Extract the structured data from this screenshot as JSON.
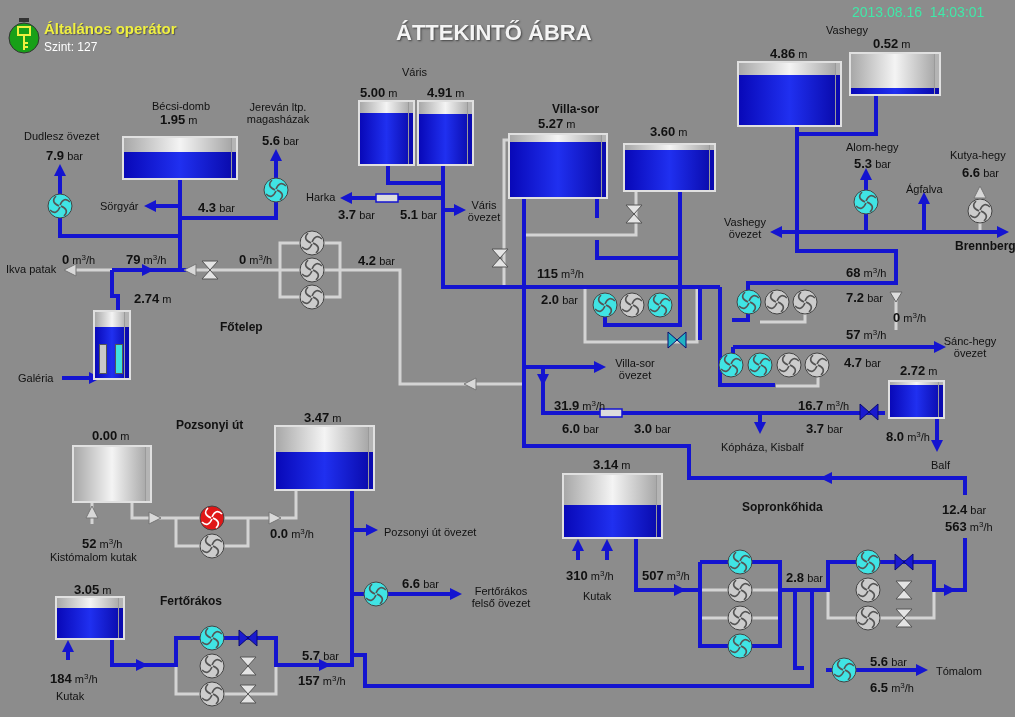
{
  "header": {
    "operator": "Általános operátor",
    "level_label": "Szint: 127",
    "title": "ÁTTEKINTŐ ÁBRA",
    "datetime": "2013.08.16  14:03:01"
  },
  "tanks": [
    {
      "kind": "tank",
      "reading": "1.95",
      "unit": "m",
      "level": 0.66
    },
    {
      "kind": "tank",
      "reading": "5.00",
      "unit": "m",
      "level": 0.82
    },
    {
      "kind": "tank",
      "reading": "4.91",
      "unit": "m",
      "level": 0.8
    },
    {
      "kind": "tank",
      "reading": "5.27",
      "unit": "m",
      "level": 0.88
    },
    {
      "kind": "tank",
      "reading": "3.60",
      "unit": "m",
      "level": 0.9
    },
    {
      "kind": "tank",
      "reading": "4.86",
      "unit": "m",
      "level": 0.8
    },
    {
      "kind": "tank",
      "reading": "0.52",
      "unit": "m",
      "level": 0.16
    },
    {
      "kind": "tank",
      "reading": "2.72",
      "unit": "m",
      "level": 0.92
    },
    {
      "kind": "tank",
      "reading": "0.00",
      "unit": "m",
      "level": 0
    },
    {
      "kind": "tank",
      "reading": "3.47",
      "unit": "m",
      "level": 0.59
    },
    {
      "kind": "tank",
      "reading": "3.05",
      "unit": "m",
      "level": 0.75
    },
    {
      "kind": "tank",
      "reading": "3.14",
      "unit": "m",
      "level": 0.52
    },
    {
      "kind": "well",
      "reading": "2.74",
      "unit": "m",
      "level": 0.78
    }
  ],
  "pumps": [
    {
      "on": true,
      "alarm": false
    },
    {
      "on": true,
      "alarm": false
    },
    {
      "on": false,
      "alarm": false
    },
    {
      "on": false,
      "alarm": false
    },
    {
      "on": false,
      "alarm": false
    },
    {
      "on": true,
      "alarm": false
    },
    {
      "on": false,
      "alarm": false
    },
    {
      "on": true,
      "alarm": false
    },
    {
      "on": true,
      "alarm": false
    },
    {
      "on": false,
      "alarm": false
    },
    {
      "on": false,
      "alarm": false
    },
    {
      "on": true,
      "alarm": false
    },
    {
      "on": true,
      "alarm": false
    },
    {
      "on": false,
      "alarm": false
    },
    {
      "on": false,
      "alarm": false
    },
    {
      "on": true,
      "alarm": false
    },
    {
      "on": false,
      "alarm": false
    },
    {
      "on": false,
      "alarm": true
    },
    {
      "on": false,
      "alarm": false
    },
    {
      "on": true,
      "alarm": false
    },
    {
      "on": true,
      "alarm": false
    },
    {
      "on": false,
      "alarm": false
    },
    {
      "on": false,
      "alarm": false
    },
    {
      "on": true,
      "alarm": false
    },
    {
      "on": false,
      "alarm": false
    },
    {
      "on": false,
      "alarm": false
    },
    {
      "on": true,
      "alarm": false
    },
    {
      "on": true,
      "alarm": false
    },
    {
      "on": false,
      "alarm": false
    },
    {
      "on": false,
      "alarm": false
    },
    {
      "on": true,
      "alarm": false
    }
  ],
  "valves": [
    {
      "open": false,
      "regulating": false
    },
    {
      "open": false,
      "regulating": false
    },
    {
      "open": false,
      "regulating": false
    },
    {
      "open": true,
      "regulating": true
    },
    {
      "open": true,
      "regulating": false
    },
    {
      "open": true,
      "regulating": false
    },
    {
      "open": false,
      "regulating": false
    },
    {
      "open": false,
      "regulating": false
    },
    {
      "open": true,
      "regulating": false
    },
    {
      "open": false,
      "regulating": false
    },
    {
      "open": false,
      "regulating": false
    }
  ],
  "readings": [
    {
      "value": "7.9",
      "unit": "bar"
    },
    {
      "value": "5.6",
      "unit": "bar"
    },
    {
      "value": "5.3",
      "unit": "bar"
    },
    {
      "value": "6.6",
      "unit": "bar"
    },
    {
      "value": "4.3",
      "unit": "bar"
    },
    {
      "value": "3.7",
      "unit": "bar"
    },
    {
      "value": "5.1",
      "unit": "bar"
    },
    {
      "value": "0",
      "unit": "m$^{3}$/h"
    },
    {
      "value": "79",
      "unit": "m$^{3}$/h"
    },
    {
      "value": "0",
      "unit": "m$^{3}$/h"
    },
    {
      "value": "4.2",
      "unit": "bar"
    },
    {
      "value": "115",
      "unit": "m$^{3}$/h"
    },
    {
      "value": "68",
      "unit": "m$^{3}$/h"
    },
    {
      "value": "2.0",
      "unit": "bar"
    },
    {
      "value": "7.2",
      "unit": "bar"
    },
    {
      "value": "0",
      "unit": "m$^{3}$/h"
    },
    {
      "value": "57",
      "unit": "m$^{3}$/h"
    },
    {
      "value": "4.7",
      "unit": "bar"
    },
    {
      "value": "31.9",
      "unit": "m$^{3}$/h"
    },
    {
      "value": "16.7",
      "unit": "m$^{3}$/h"
    },
    {
      "value": "6.0",
      "unit": "bar"
    },
    {
      "value": "3.0",
      "unit": "bar"
    },
    {
      "value": "3.7",
      "unit": "bar"
    },
    {
      "value": "8.0",
      "unit": "m$^{3}$/h"
    },
    {
      "value": "12.4",
      "unit": "bar"
    },
    {
      "value": "563",
      "unit": "m$^{3}$/h"
    },
    {
      "value": "52",
      "unit": "m$^{3}$/h"
    },
    {
      "value": "0.0",
      "unit": "m$^{3}$/h"
    },
    {
      "value": "6.6",
      "unit": "bar"
    },
    {
      "value": "310",
      "unit": "m$^{3}$/h"
    },
    {
      "value": "507",
      "unit": "m$^{3}$/h"
    },
    {
      "value": "2.8",
      "unit": "bar"
    },
    {
      "value": "5.7",
      "unit": "bar"
    },
    {
      "value": "5.6",
      "unit": "bar"
    },
    {
      "value": "184",
      "unit": "m$^{3}$/h"
    },
    {
      "value": "157",
      "unit": "m$^{3}$/h"
    },
    {
      "value": "6.5",
      "unit": "m$^{3}$/h"
    }
  ],
  "labels": [
    {
      "text": "Vashegy",
      "kind": "place"
    },
    {
      "text": "Váris",
      "kind": "place"
    },
    {
      "text": "Bécsi-domb",
      "kind": "place"
    },
    {
      "text": "Jereván ltp. magasházak",
      "kind": "place"
    },
    {
      "text": "Villa-sor",
      "kind": "station"
    },
    {
      "text": "Dudlesz övezet",
      "kind": "place"
    },
    {
      "text": "Alom-hegy",
      "kind": "place"
    },
    {
      "text": "Kutya-hegy",
      "kind": "place"
    },
    {
      "text": "Ágfalva",
      "kind": "place"
    },
    {
      "text": "Sörgyár",
      "kind": "place"
    },
    {
      "text": "Harka",
      "kind": "place"
    },
    {
      "text": "Váris övezet",
      "kind": "place"
    },
    {
      "text": "Vashegy övezet",
      "kind": "place"
    },
    {
      "text": "Brennberg",
      "kind": "station"
    },
    {
      "text": "Ikva patak",
      "kind": "place"
    },
    {
      "text": "Főtelep",
      "kind": "station"
    },
    {
      "text": "Sánc-hegy övezet",
      "kind": "place"
    },
    {
      "text": "Galéria",
      "kind": "place"
    },
    {
      "text": "Villa-sor övezet",
      "kind": "place"
    },
    {
      "text": "Pozsonyi út",
      "kind": "station"
    },
    {
      "text": "Kópháza, Kisbalf",
      "kind": "place"
    },
    {
      "text": "Balf",
      "kind": "place"
    },
    {
      "text": "Sopronkőhida",
      "kind": "station"
    },
    {
      "text": "Pozsonyi út övezet",
      "kind": "place"
    },
    {
      "text": "Kistómalom kutak",
      "kind": "place"
    },
    {
      "text": "Fertőrákos",
      "kind": "station"
    },
    {
      "text": "Fertőrákos felső övezet",
      "kind": "place"
    },
    {
      "text": "Kutak",
      "kind": "place"
    },
    {
      "text": "Tómalom",
      "kind": "place"
    },
    {
      "text": "Kutak",
      "kind": "place"
    }
  ]
}
